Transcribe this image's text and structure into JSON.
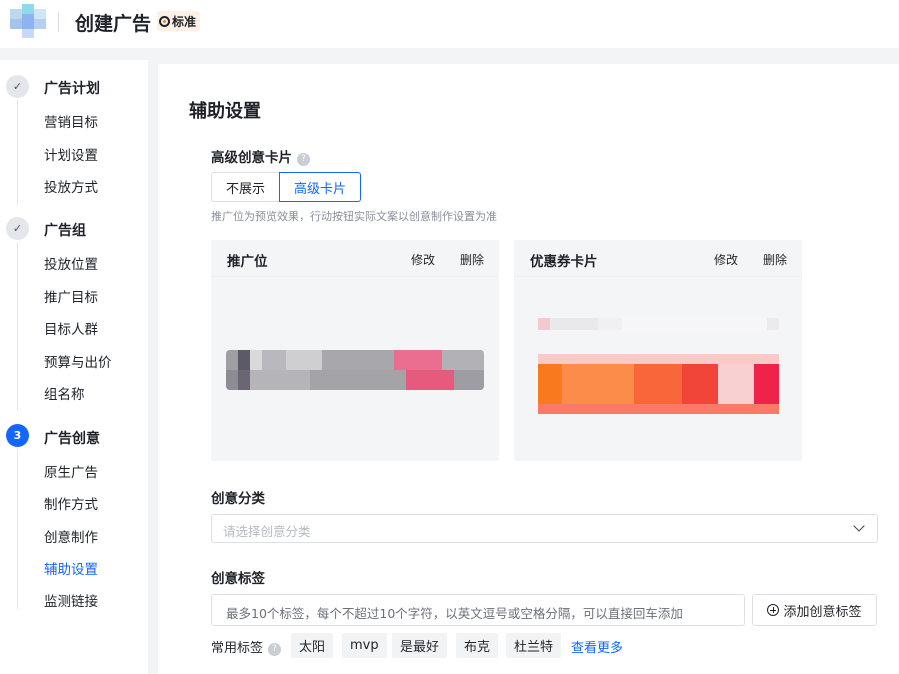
{
  "header": {
    "title": "创建广告",
    "badge": "标准",
    "badge_icon": "medal-icon"
  },
  "sidebar": {
    "steps": [
      {
        "title": "广告计划",
        "status": "done",
        "items": [
          "营销目标",
          "计划设置",
          "投放方式"
        ]
      },
      {
        "title": "广告组",
        "status": "done",
        "items": [
          "投放位置",
          "推广目标",
          "目标人群",
          "预算与出价",
          "组名称"
        ]
      },
      {
        "number": "3",
        "title": "广告创意",
        "status": "active",
        "items": [
          "原生广告",
          "制作方式",
          "创意制作",
          "辅助设置",
          "监测链接"
        ],
        "active_item": "辅助设置"
      }
    ]
  },
  "main": {
    "title": "辅助设置",
    "advanced_card": {
      "label": "高级创意卡片",
      "options": [
        "不展示",
        "高级卡片"
      ],
      "selected": "高级卡片",
      "hint": "推广位为预览效果，行动按钮实际文案以创意制作设置为准"
    },
    "preview_cards": [
      {
        "title": "推广位",
        "edit": "修改",
        "delete": "删除"
      },
      {
        "title": "优惠券卡片",
        "edit": "修改",
        "delete": "删除"
      }
    ],
    "category": {
      "label": "创意分类",
      "placeholder": "请选择创意分类"
    },
    "tags": {
      "label": "创意标签",
      "placeholder": "最多10个标签，每个不超过10个字符，以英文逗号或空格分隔，可以直接回车添加",
      "add_button": "添加创意标签",
      "common_label": "常用标签",
      "common_tags": [
        "太阳",
        "mvp",
        "是最好",
        "布克",
        "杜兰特"
      ],
      "more_link": "查看更多"
    }
  },
  "colors": {
    "accent": "#1366ff",
    "background": "#f3f4f6"
  }
}
